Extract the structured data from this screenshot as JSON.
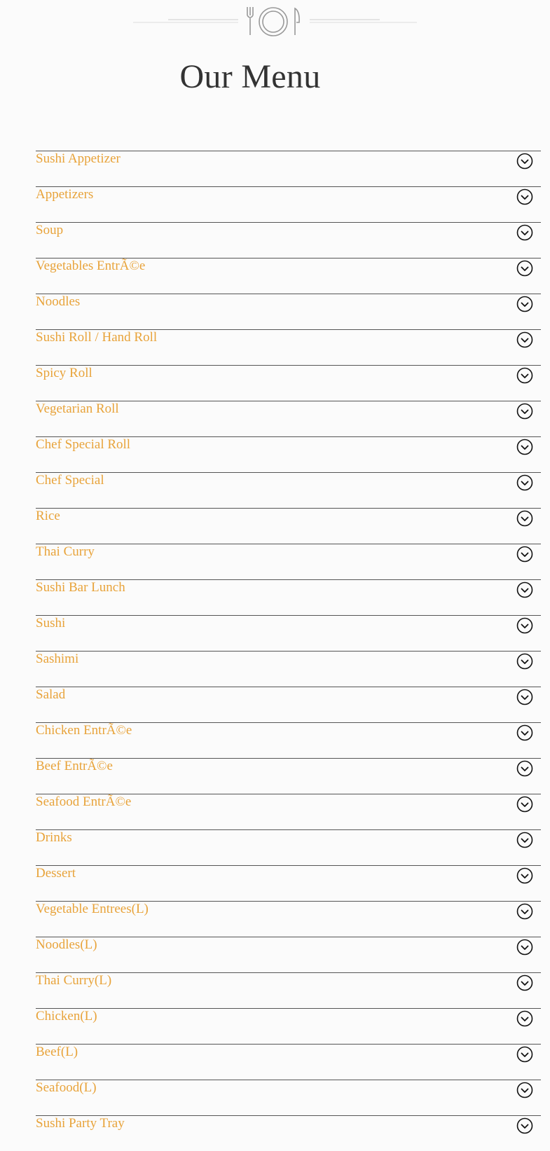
{
  "page": {
    "title": "Our Menu",
    "accent_color": "#e8a33a",
    "divider_color": "#555555",
    "header_icon": "plate-fork-knife-icon",
    "item_icon": "chevron-down-circle-icon"
  },
  "menu": {
    "categories": [
      {
        "label": "Sushi Appetizer"
      },
      {
        "label": "Appetizers"
      },
      {
        "label": "Soup"
      },
      {
        "label": "Vegetables EntrÃ©e"
      },
      {
        "label": "Noodles"
      },
      {
        "label": "Sushi Roll / Hand Roll"
      },
      {
        "label": "Spicy Roll"
      },
      {
        "label": "Vegetarian Roll"
      },
      {
        "label": "Chef Special Roll"
      },
      {
        "label": "Chef Special"
      },
      {
        "label": "Rice"
      },
      {
        "label": "Thai Curry"
      },
      {
        "label": "Sushi Bar Lunch"
      },
      {
        "label": "Sushi"
      },
      {
        "label": "Sashimi"
      },
      {
        "label": "Salad"
      },
      {
        "label": "Chicken EntrÃ©e"
      },
      {
        "label": "Beef EntrÃ©e"
      },
      {
        "label": "Seafood EntrÃ©e"
      },
      {
        "label": "Drinks"
      },
      {
        "label": "Dessert"
      },
      {
        "label": "Vegetable Entrees(L)"
      },
      {
        "label": "Noodles(L)"
      },
      {
        "label": "Thai Curry(L)"
      },
      {
        "label": "Chicken(L)"
      },
      {
        "label": "Beef(L)"
      },
      {
        "label": "Seafood(L)"
      },
      {
        "label": "Sushi Party Tray"
      }
    ]
  }
}
